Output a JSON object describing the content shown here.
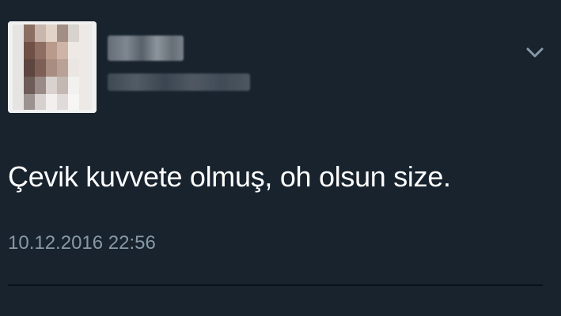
{
  "tweet": {
    "text": "Çevik kuvvete olmuş, oh olsun size.",
    "timestamp": "10.12.2016 22:56"
  },
  "icons": {
    "menu": "chevron-down-icon"
  },
  "colors": {
    "background": "#18232e",
    "text_primary": "#ffffff",
    "text_secondary": "#8899a6",
    "divider": "#0a1117"
  }
}
